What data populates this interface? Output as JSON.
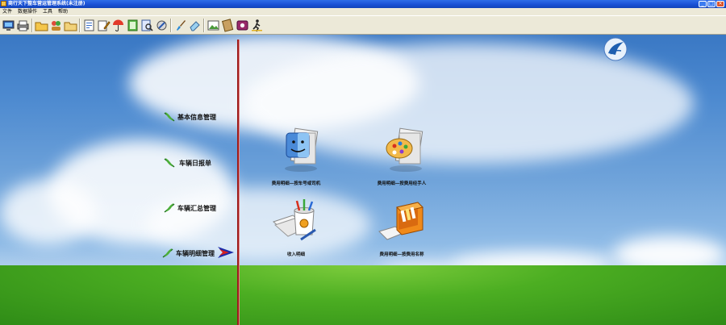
{
  "window": {
    "title": "商行天下整车营运管理系统(未注册)"
  },
  "menu": {
    "items": [
      "文件",
      "数据操作",
      "工具",
      "帮助"
    ]
  },
  "nav": {
    "items": [
      {
        "label": "基本信息管理"
      },
      {
        "label": "车辆日报单"
      },
      {
        "label": "车辆汇总管理"
      },
      {
        "label": "车辆明细管理"
      }
    ]
  },
  "functions": {
    "items": [
      {
        "label": "费用明细—按车号或司机"
      },
      {
        "label": "费用明细—按费用经手人"
      },
      {
        "label": "收入明细"
      },
      {
        "label": "费用明细—按费用名称"
      }
    ]
  },
  "colors": {
    "titlebar": "#1a51d6",
    "divider": "#9c1c1c",
    "nav_arrow": "#1a2aa8"
  }
}
